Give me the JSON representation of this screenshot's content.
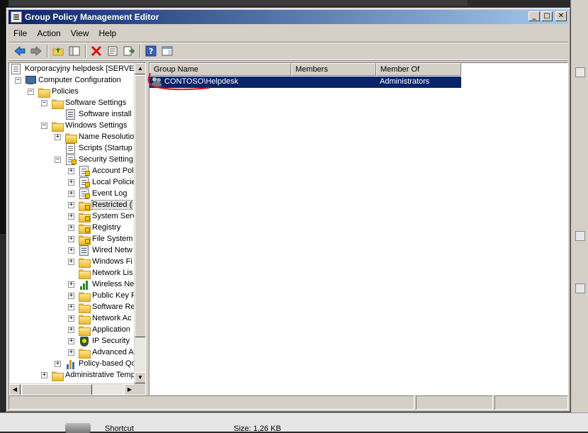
{
  "window": {
    "title": "Group Policy Management Editor",
    "min_glyph": "_",
    "max_glyph": "□",
    "close_glyph": "✕"
  },
  "menu": [
    "File",
    "Action",
    "View",
    "Help"
  ],
  "toolbar": {
    "icons": [
      "back-arrow-icon",
      "forward-arrow-icon",
      "up-folder-icon",
      "show-hide-tree-icon",
      "delete-icon",
      "properties-icon",
      "export-list-icon",
      "help-icon",
      "show-pane-icon"
    ]
  },
  "tree": {
    "root": "Korporacyjny helpdesk [SERVER",
    "computer_configuration": "Computer Configuration",
    "policies": "Policies",
    "software_settings": "Software Settings",
    "software_install": "Software install",
    "windows_settings": "Windows Settings",
    "name_resolution": "Name Resolutio",
    "scripts": "Scripts (Startup",
    "security_settings": "Security Setting",
    "account_policies": "Account Pol",
    "local_policies": "Local Policie",
    "event_log": "Event Log",
    "restricted_groups": "Restricted (",
    "system_services": "System Serv",
    "registry": "Registry",
    "file_system": "File System",
    "wired_network": "Wired Netw",
    "windows_firewall": "Windows Fi",
    "network_list": "Network Lis",
    "wireless_network": "Wireless Ne",
    "public_key": "Public Key P",
    "software_restriction": "Software Re",
    "network_access": "Network Ac",
    "application_control": "Application",
    "ip_security": "IP Security",
    "advanced_audit": "Advanced A",
    "policy_based_qos": "Policy-based Qo",
    "administrative_templates": "Administrative Temp"
  },
  "list": {
    "columns": [
      "Group Name",
      "Members",
      "Member Of"
    ],
    "rows": [
      {
        "group_name": "CONTOSO\\Helpdesk",
        "members": "",
        "member_of": "Administrators"
      }
    ]
  },
  "background": {
    "shortcut": "Shortcut",
    "size": "Size: 1,26 KB"
  },
  "colors": {
    "title_gradient_start": "#0a246a",
    "title_gradient_end": "#a6caf0",
    "selection": "#0a246a",
    "annotation": "#e0141e"
  }
}
